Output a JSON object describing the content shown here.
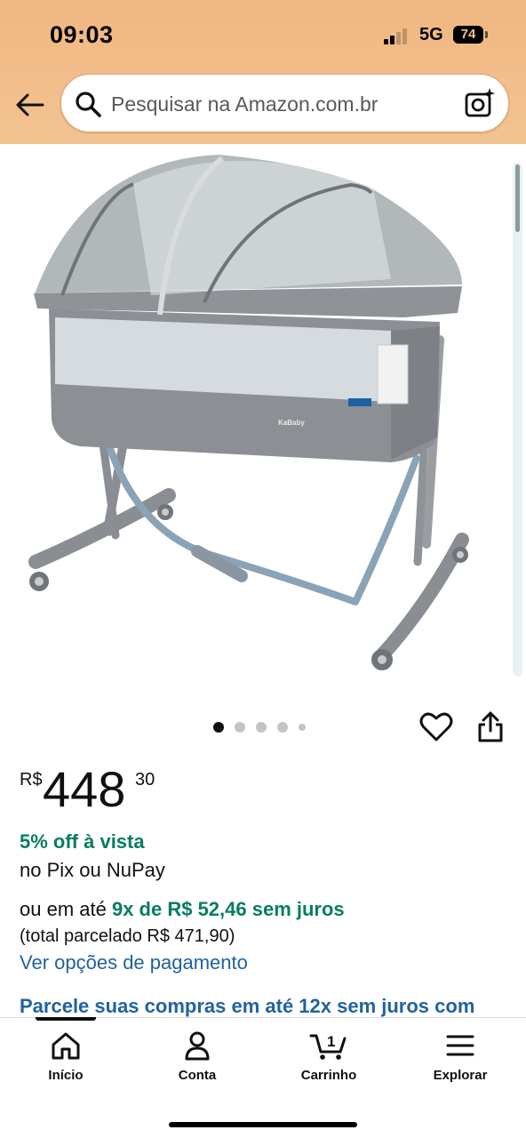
{
  "status_bar": {
    "time": "09:03",
    "network": "5G",
    "battery": "74"
  },
  "header": {
    "back_icon": "arrow-left-icon",
    "search": {
      "placeholder": "Pesquisar na Amazon.com.br",
      "icon": "search-icon",
      "camera_icon": "camera-icon"
    }
  },
  "product": {
    "image_brand_label": "KaBaby",
    "carousel": {
      "count": 5,
      "active_index": 0
    },
    "actions": {
      "wishlist_icon": "heart-icon",
      "share_icon": "share-icon"
    },
    "price": {
      "currency": "R$",
      "whole": "448",
      "fraction": "30"
    },
    "discount": "5% off à vista",
    "payment_methods": "no Pix ou NuPay",
    "installments": {
      "prefix": "ou em até",
      "highlight": "9x de R$ 52,46 sem juros"
    },
    "total_installment": "(total parcelado R$ 471,90)",
    "payment_options_link": "Ver opções de pagamento",
    "promo_banner": "Parcele suas compras em até 12x sem juros com"
  },
  "bottom_nav": {
    "items": [
      {
        "label": "Início",
        "icon": "home-icon"
      },
      {
        "label": "Conta",
        "icon": "person-icon"
      },
      {
        "label": "Carrinho",
        "icon": "cart-icon",
        "badge": "1"
      },
      {
        "label": "Explorar",
        "icon": "menu-icon"
      }
    ]
  },
  "colors": {
    "header": "#f3c392",
    "price_green": "#067d62",
    "link_blue": "#2162a1"
  }
}
